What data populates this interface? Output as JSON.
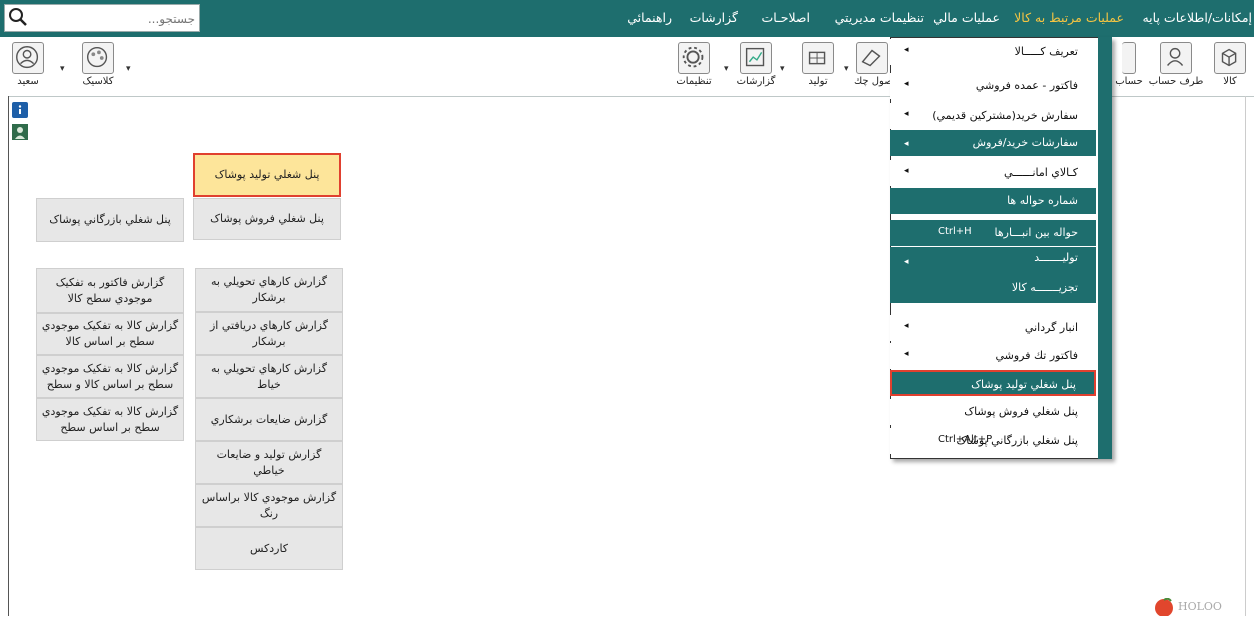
{
  "search": {
    "placeholder": "جستجو..."
  },
  "menubar": {
    "items": [
      {
        "label": "إمكانات/اطلاعات پايه"
      },
      {
        "label": "عمليات مرتبط به كالا"
      },
      {
        "label": "عمليات مالي"
      },
      {
        "label": "تنظيمات مديريتي"
      },
      {
        "label": "اصلاحـات"
      },
      {
        "label": "گزارشات"
      },
      {
        "label": "راهنمائي"
      }
    ]
  },
  "toolbar": {
    "left": [
      {
        "label": "سعيد",
        "icon": "user-icon"
      },
      {
        "label": "كلاسيک",
        "icon": "palette-icon"
      }
    ],
    "right": [
      {
        "label": "تنظيمات",
        "icon": "gear-icon"
      },
      {
        "label": "گزارشات",
        "icon": "report-icon"
      },
      {
        "label": "توليد",
        "icon": "factory-icon"
      },
      {
        "label": "صول چك",
        "icon": "cheque-icon"
      },
      {
        "label": "حساب",
        "icon": "account-icon"
      },
      {
        "label": "طرف حساب",
        "icon": "contact-icon"
      },
      {
        "label": "كالا",
        "icon": "box-icon"
      }
    ]
  },
  "panel": {
    "top_highlight": "پنل شغلي توليد پوشاک",
    "sales_panel": "پنل شغلي فروش پوشاک",
    "commerce_panel": "پنل شغلي بازرگاني پوشاک",
    "reports_mid": [
      "گزارش كارهاي تحويلي به برشكار",
      "گزارش كارهاي دريافتي از برشكار",
      "گزارش كارهاي تحويلي به خياط",
      "گزارش ضايعات برشكاري",
      "گزارش توليد و ضايعات خياطي",
      "گزارش موجودي كالا براساس رنگ",
      "كاردكس"
    ],
    "reports_left": [
      "گزارش فاكتور به تفكيک موجودي سطح كالا",
      "گزارش كالا به تفكيک موجودي سطح بر اساس كالا",
      "گزارش كالا به تفكيک موجودي سطح بر اساس كالا و سطح",
      "گزارش كالا به تفكيک موجودي سطح بر اساس سطح"
    ]
  },
  "dropdown": {
    "items": [
      {
        "label": "تعريف كـــــالا",
        "arrow": "◂",
        "shortcut": "",
        "style": "light"
      },
      {
        "label": "فاكتور - عمده فروشي",
        "arrow": "◂",
        "shortcut": "",
        "style": "light"
      },
      {
        "label": "سفارش خريد(مشتركين قديمي)",
        "arrow": "◂",
        "shortcut": "",
        "style": "light"
      },
      {
        "label": "سفارشات خريد/فروش",
        "arrow": "◂",
        "shortcut": "",
        "style": "dark"
      },
      {
        "label": "كـالاي امانــــــي",
        "arrow": "◂",
        "shortcut": "",
        "style": "light"
      },
      {
        "label": "شماره حواله ها",
        "arrow": "",
        "shortcut": "",
        "style": "dark"
      },
      {
        "label": "حواله بين انبـــارها",
        "arrow": "",
        "shortcut": "Ctrl+H",
        "style": "dark"
      },
      {
        "label": "توليـــــــد",
        "arrow": "◂",
        "shortcut": "",
        "style": "dark"
      },
      {
        "label": "تجزيـــــــه كالا",
        "arrow": "",
        "shortcut": "",
        "style": "dark"
      },
      {
        "label": "انبار گرداني",
        "arrow": "◂",
        "shortcut": "",
        "style": "light"
      },
      {
        "label": "فاكتور تك فروشي",
        "arrow": "◂",
        "shortcut": "",
        "style": "light"
      },
      {
        "label": "پنل شغلي توليد پوشاک",
        "arrow": "",
        "shortcut": "",
        "style": "sel"
      },
      {
        "label": "پنل شغلي فروش پوشاک",
        "arrow": "",
        "shortcut": "",
        "style": "light"
      },
      {
        "label": "پنل شغلي بازرگاني پوشاک",
        "arrow": "",
        "shortcut": "Ctrl+Alt+P",
        "style": "light"
      }
    ]
  },
  "colors": {
    "menubar": "#1e6e6e",
    "active_menu_text": "#f5c542",
    "highlight_fill": "#fde59a",
    "highlight_border": "#e0402f"
  },
  "logo": {
    "text": "HOLOO"
  }
}
